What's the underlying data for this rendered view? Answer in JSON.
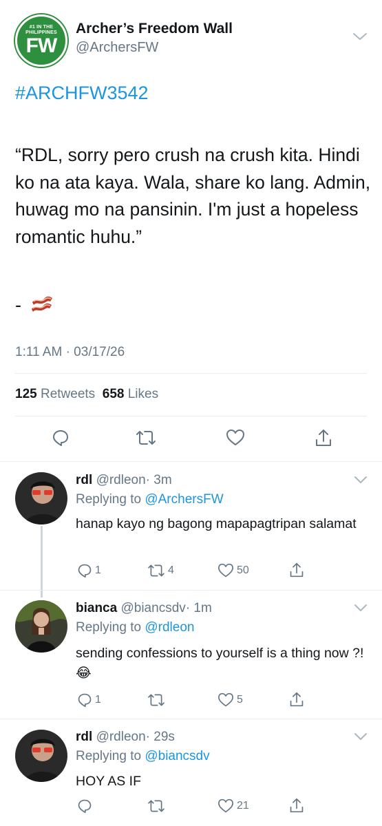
{
  "account": {
    "name": "Archer’s Freedom Wall",
    "handle": "@ArchersFW",
    "logo_ring_text": "#1 IN THE PHILIPPINES",
    "logo_text": "FW",
    "brand_color": "#2e8f3e"
  },
  "tweet": {
    "hashtag": "#ARCHFW3542",
    "text": "“RDL, sorry pero crush na crush kita. Hindi ko na ata kaya. Wala, share ko lang. Admin, huwag mo na pansinin. I'm just a hopeless romantic huhu.”",
    "signature": "-",
    "signature_emoji": "bacon",
    "timestamp": "1:11 AM · 03/17/26",
    "retweets_count": "125",
    "retweets_label": "Retweets",
    "likes_count": "658",
    "likes_label": "Likes"
  },
  "replies": [
    {
      "name": "rdl",
      "handle": "@rdleon",
      "time": "· 3m",
      "replying_label": "Replying to",
      "replying_to": "@ArchersFW",
      "text": "hanap kayo ng bagong mapapagtripan salamat",
      "reply_count": "1",
      "retweet_count": "4",
      "like_count": "50"
    },
    {
      "name": "bianca",
      "handle": "@biancsdv",
      "time": "· 1m",
      "replying_label": "Replying to",
      "replying_to": "@rdleon",
      "text": "sending confessions to yourself is a thing now ?! 😂",
      "reply_count": "1",
      "retweet_count": "",
      "like_count": "5"
    },
    {
      "name": "rdl",
      "handle": "@rdleon",
      "time": "· 29s",
      "replying_label": "Replying to",
      "replying_to": "@biancsdv",
      "text": "HOY AS IF",
      "reply_count": "",
      "retweet_count": "",
      "like_count": "21"
    }
  ],
  "colors": {
    "link": "#1b95e0",
    "secondary_text": "#657786",
    "divider": "#e6ecf0"
  }
}
